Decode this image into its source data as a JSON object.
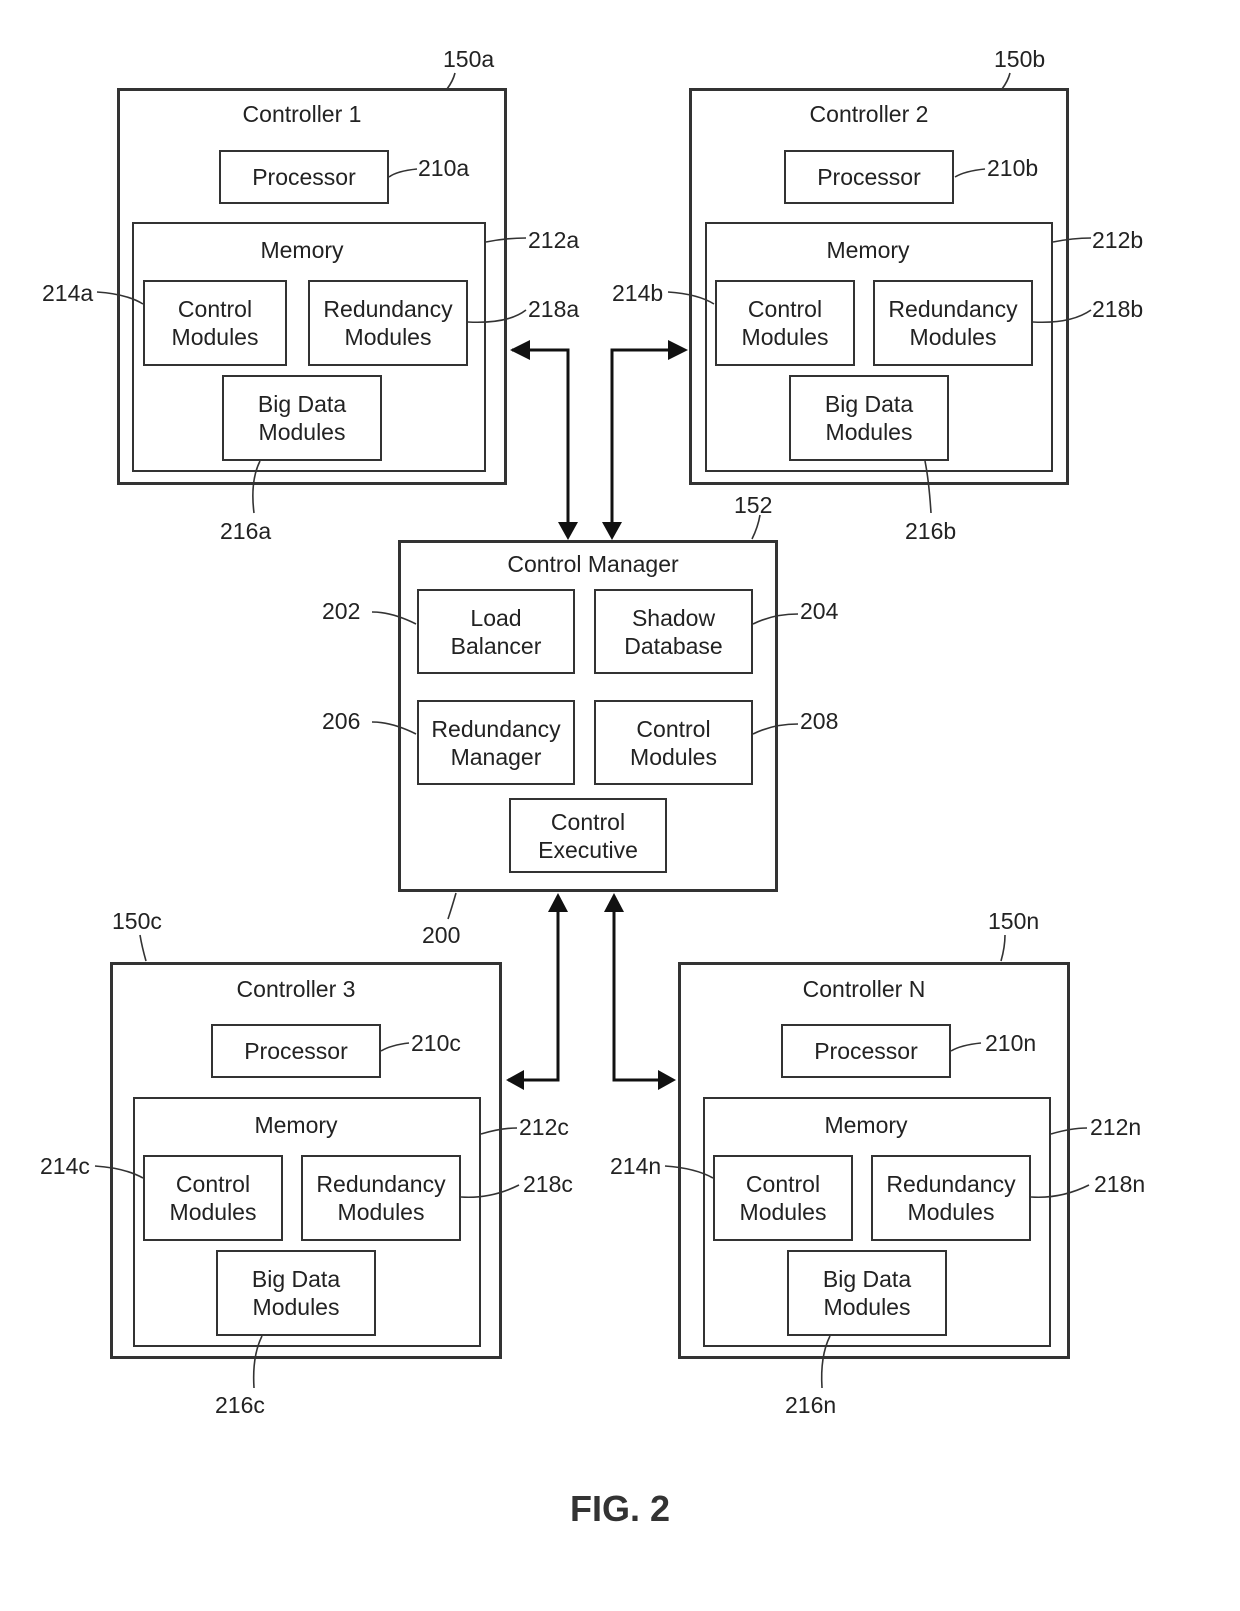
{
  "figure_label": "FIG. 2",
  "controllers": [
    {
      "ref": "150a",
      "title": "Controller 1",
      "processor": "Processor",
      "processor_ref": "210a",
      "memory": "Memory",
      "memory_ref": "212a",
      "control": "Control\nModules",
      "control_ref": "214a",
      "redundancy": "Redundancy\nModules",
      "redundancy_ref": "218a",
      "bigdata": "Big Data\nModules",
      "bigdata_ref": "216a"
    },
    {
      "ref": "150b",
      "title": "Controller 2",
      "processor": "Processor",
      "processor_ref": "210b",
      "memory": "Memory",
      "memory_ref": "212b",
      "control": "Control\nModules",
      "control_ref": "214b",
      "redundancy": "Redundancy\nModules",
      "redundancy_ref": "218b",
      "bigdata": "Big Data\nModules",
      "bigdata_ref": "216b"
    },
    {
      "ref": "150c",
      "title": "Controller 3",
      "processor": "Processor",
      "processor_ref": "210c",
      "memory": "Memory",
      "memory_ref": "212c",
      "control": "Control\nModules",
      "control_ref": "214c",
      "redundancy": "Redundancy\nModules",
      "redundancy_ref": "218c",
      "bigdata": "Big Data\nModules",
      "bigdata_ref": "216c"
    },
    {
      "ref": "150n",
      "title": "Controller N",
      "processor": "Processor",
      "processor_ref": "210n",
      "memory": "Memory",
      "memory_ref": "212n",
      "control": "Control\nModules",
      "control_ref": "214n",
      "redundancy": "Redundancy\nModules",
      "redundancy_ref": "218n",
      "bigdata": "Big Data\nModules",
      "bigdata_ref": "216n"
    }
  ],
  "manager": {
    "ref": "152",
    "bottom_ref": "200",
    "title": "Control Manager",
    "load_balancer": "Load\nBalancer",
    "load_balancer_ref": "202",
    "shadow_db": "Shadow\nDatabase",
    "shadow_db_ref": "204",
    "redundancy_manager": "Redundancy\nManager",
    "redundancy_manager_ref": "206",
    "control_modules": "Control\nModules",
    "control_modules_ref": "208",
    "control_executive": "Control\nExecutive"
  }
}
